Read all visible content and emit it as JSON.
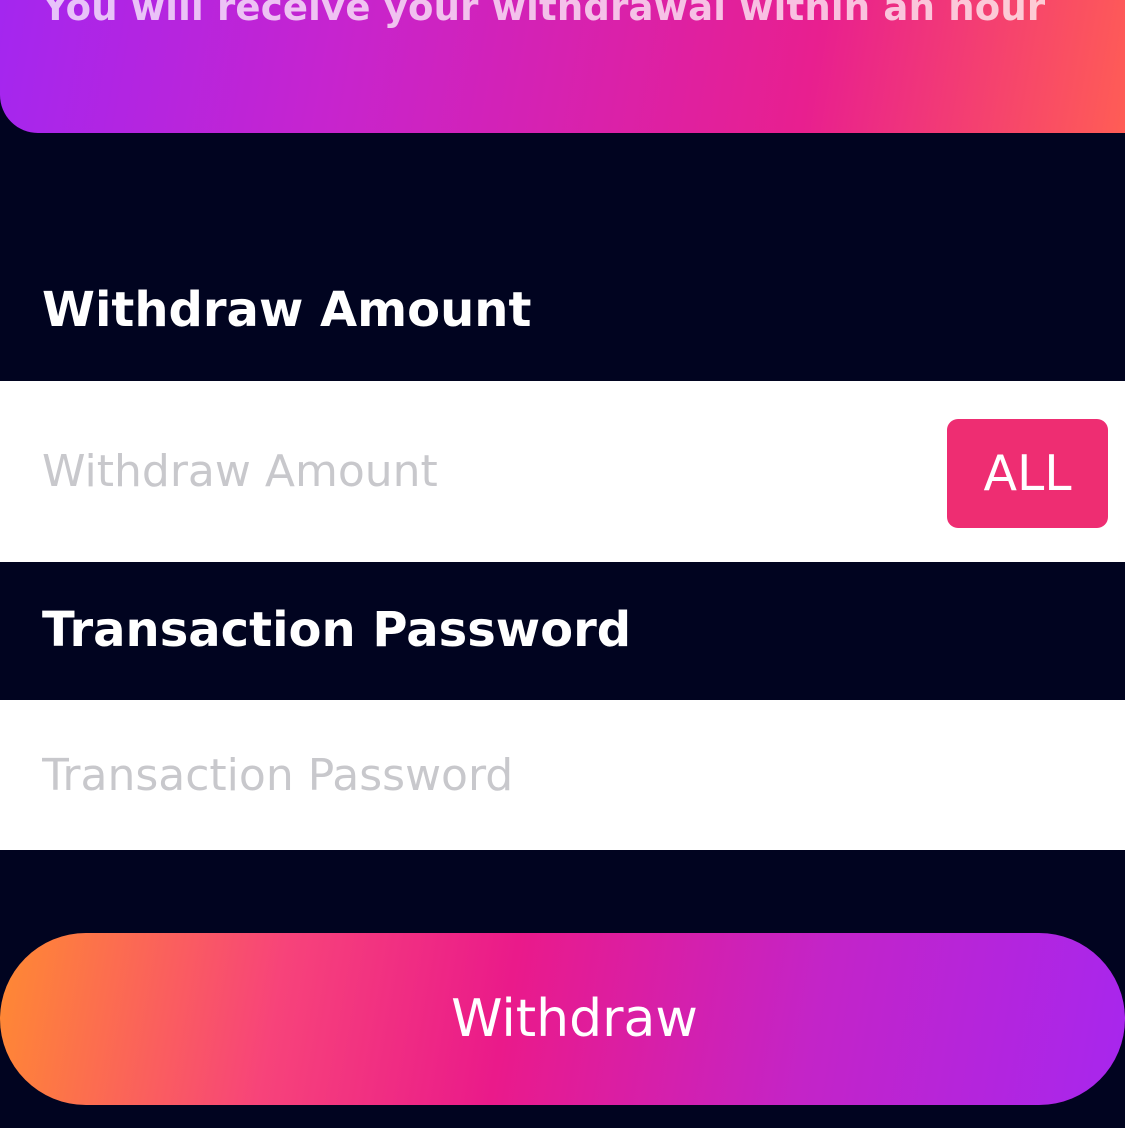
{
  "notice": {
    "text": "You will receive your withdrawal within an hour"
  },
  "amount": {
    "label": "Withdraw Amount",
    "placeholder": "Withdraw Amount",
    "value": "",
    "all_button_label": "ALL"
  },
  "password": {
    "label": "Transaction Password",
    "placeholder": "Transaction Password",
    "value": ""
  },
  "submit": {
    "label": "Withdraw"
  },
  "colors": {
    "background": "#010420",
    "accent_pink": "#ee2d72",
    "gradient_purple": "#a326f0",
    "gradient_magenta": "#e81f8f",
    "gradient_orange": "#ff8a32",
    "input_background": "#ffffff",
    "placeholder_gray": "#c8c8cc"
  }
}
